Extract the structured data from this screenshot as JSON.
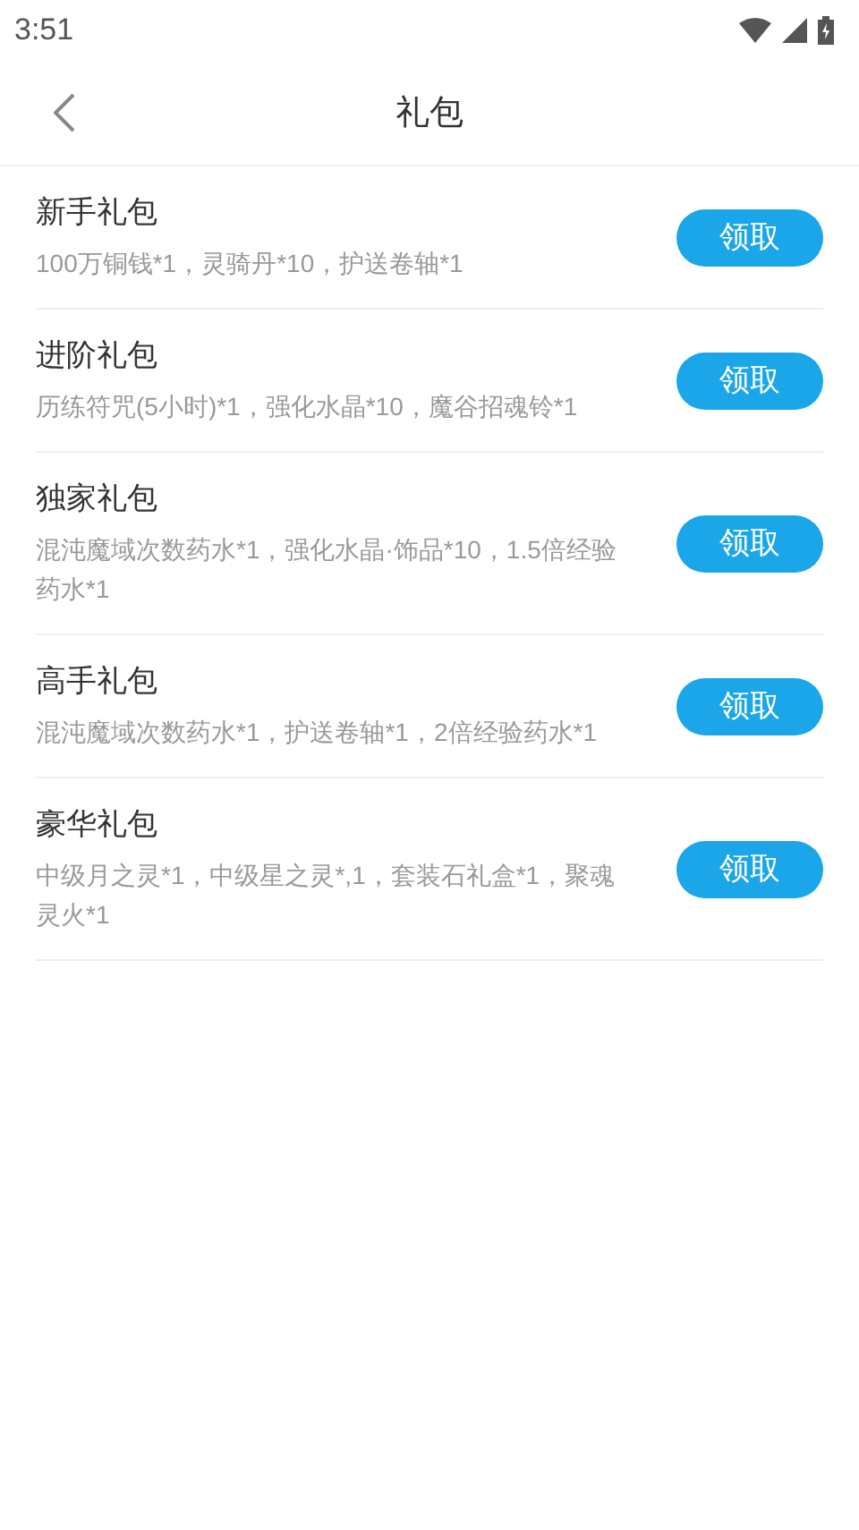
{
  "status_bar": {
    "time": "3:51"
  },
  "header": {
    "title": "礼包"
  },
  "gifts": [
    {
      "name": "新手礼包",
      "contents": "100万铜钱*1，灵骑丹*10，护送卷轴*1",
      "button": "领取"
    },
    {
      "name": "进阶礼包",
      "contents": "历练符咒(5小时)*1，强化水晶*10，魔谷招魂铃*1",
      "button": "领取"
    },
    {
      "name": "独家礼包",
      "contents": "混沌魔域次数药水*1，强化水晶·饰品*10，1.5倍经验药水*1",
      "button": "领取"
    },
    {
      "name": "高手礼包",
      "contents": "混沌魔域次数药水*1，护送卷轴*1，2倍经验药水*1",
      "button": "领取"
    },
    {
      "name": "豪华礼包",
      "contents": "中级月之灵*1，中级星之灵*,1，套装石礼盒*1，聚魂灵火*1",
      "button": "领取"
    }
  ]
}
